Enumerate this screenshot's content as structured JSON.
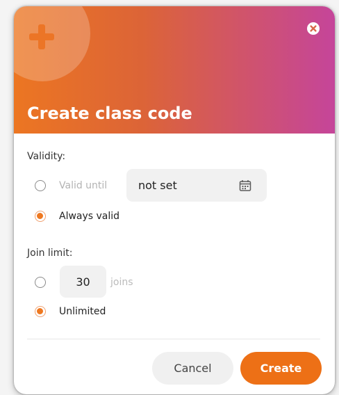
{
  "dialog": {
    "title": "Create class code",
    "close_icon": "close-circle-icon",
    "header_icon": "plus-icon",
    "gradient_colors": [
      "#ec7622",
      "#dc6437",
      "#c5459a"
    ],
    "accent_color": "#ed7016"
  },
  "validity": {
    "label": "Validity:",
    "options": [
      {
        "label": "Valid until",
        "checked": false,
        "enabled": false
      },
      {
        "label": "Always valid",
        "checked": true,
        "enabled": true
      }
    ],
    "date_value": "not set",
    "date_icon": "calendar-icon"
  },
  "join_limit": {
    "label": "Join limit:",
    "options": [
      {
        "label": "",
        "checked": false
      },
      {
        "label": "Unlimited",
        "checked": true
      }
    ],
    "count_value": "30",
    "unit": "joins"
  },
  "actions": {
    "cancel_label": "Cancel",
    "create_label": "Create"
  }
}
